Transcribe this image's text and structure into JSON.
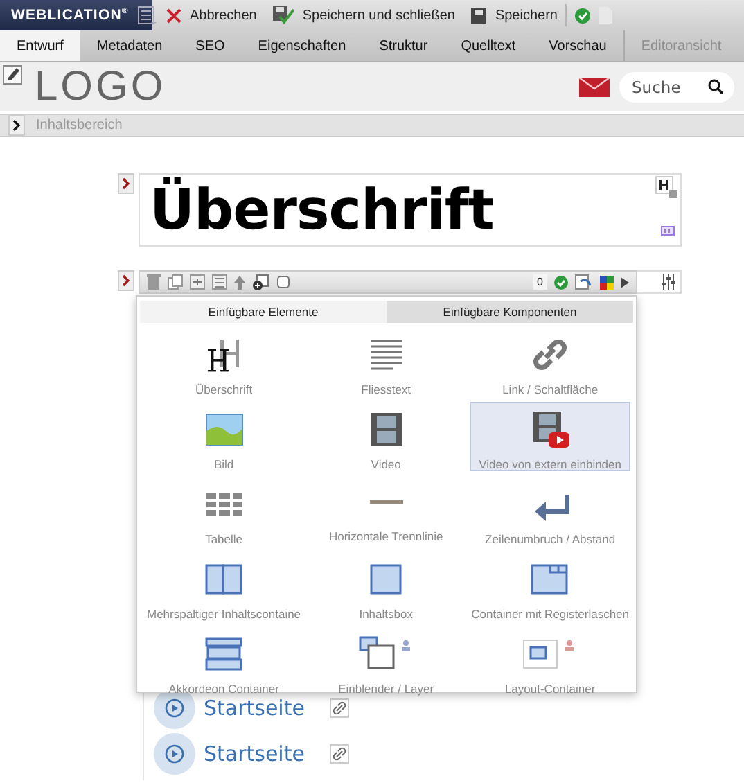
{
  "topbar": {
    "brand": "WEBLICATION$^{®}$",
    "actions": [
      {
        "kind": "cancel",
        "label": "Abbrechen"
      },
      {
        "kind": "save-close",
        "label": "Speichern und schließen"
      },
      {
        "kind": "save",
        "label": "Speichern"
      }
    ]
  },
  "tabs": [
    {
      "label": "Entwurf",
      "selected": true,
      "disabled": false
    },
    {
      "label": "Metadaten",
      "selected": false,
      "disabled": false
    },
    {
      "label": "SEO",
      "selected": false,
      "disabled": false
    },
    {
      "label": "Eigenschaften",
      "selected": false,
      "disabled": false
    },
    {
      "label": "Struktur",
      "selected": false,
      "disabled": false
    },
    {
      "label": "Quelltext",
      "selected": false,
      "disabled": false
    },
    {
      "label": "Vorschau",
      "selected": false,
      "disabled": false
    },
    {
      "label": "Editoransicht",
      "selected": false,
      "disabled": true
    }
  ],
  "header": {
    "logo": "LOGO",
    "search": {
      "placeholder": "Suche"
    }
  },
  "breadcrumb": "Inhaltsbereich",
  "heading": "Überschrift",
  "element_toolbar": {
    "checked": false,
    "counter": "0"
  },
  "insert_panel": {
    "tabs": [
      {
        "label": "Einfügbare Elemente",
        "selected": true
      },
      {
        "label": "Einfügbare Komponenten",
        "selected": false
      }
    ],
    "items": [
      {
        "kind": "heading",
        "label": "Überschrift",
        "selected": false
      },
      {
        "kind": "text",
        "label": "Fliesstext",
        "selected": false
      },
      {
        "kind": "link",
        "label": "Link / Schaltfläche",
        "selected": false
      },
      {
        "kind": "image",
        "label": "Bild",
        "selected": false
      },
      {
        "kind": "video",
        "label": "Video",
        "selected": false
      },
      {
        "kind": "video-external",
        "label": "Video von extern einbinden",
        "selected": true
      },
      {
        "kind": "table",
        "label": "Tabelle",
        "selected": false
      },
      {
        "kind": "rule",
        "label": "Horizontale Trennlinie",
        "selected": false
      },
      {
        "kind": "break",
        "label": "Zeilenumbruch / Abstand",
        "selected": false
      },
      {
        "kind": "columns",
        "label": "Mehrspaltiger Inhaltscontaine",
        "selected": false
      },
      {
        "kind": "box",
        "label": "Inhaltsbox",
        "selected": false
      },
      {
        "kind": "tabs",
        "label": "Container mit Registerlaschen",
        "selected": false
      },
      {
        "kind": "accordion",
        "label": "Akkordeon Container",
        "selected": false
      },
      {
        "kind": "layer",
        "label": "Einblender / Layer",
        "selected": false
      },
      {
        "kind": "layout",
        "label": "Layout-Container",
        "selected": false
      }
    ]
  },
  "links": [
    {
      "label": "Startseite"
    },
    {
      "label": "Startseite"
    }
  ]
}
